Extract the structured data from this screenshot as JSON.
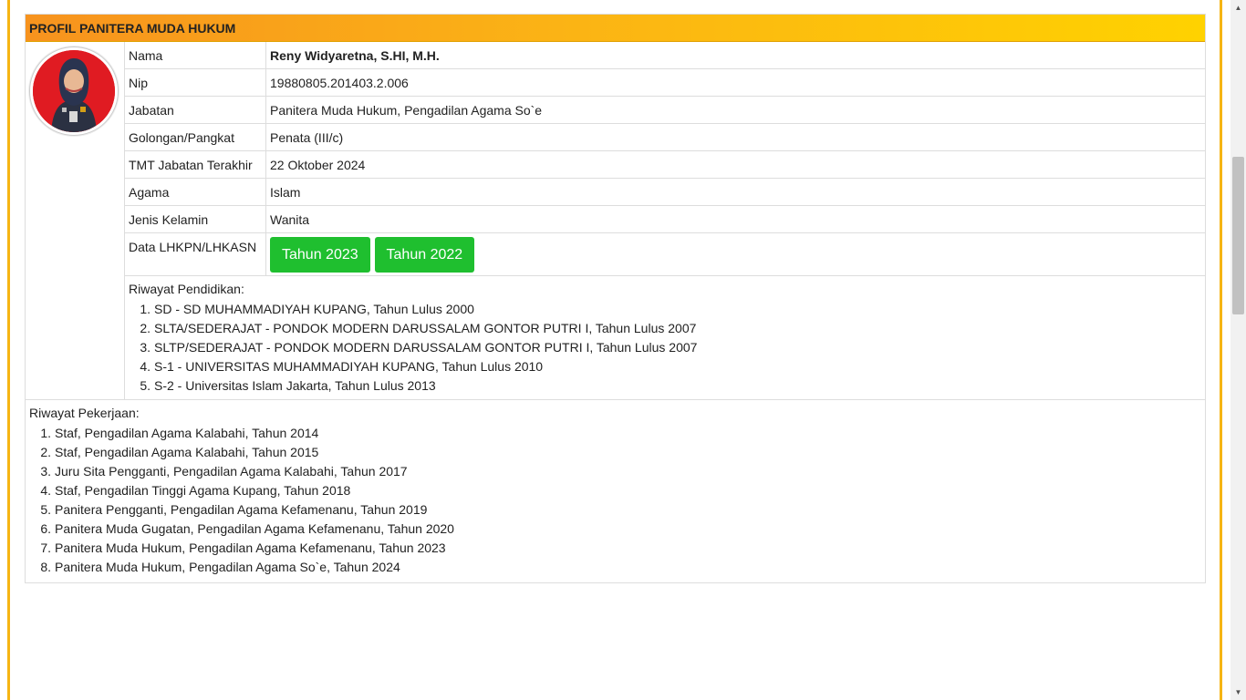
{
  "panel": {
    "title": "PROFIL PANITERA MUDA HUKUM"
  },
  "profile": {
    "rows": [
      {
        "label": "Nama",
        "value": "Reny Widyaretna, S.HI, M.H."
      },
      {
        "label": "Nip",
        "value": "19880805.201403.2.006"
      },
      {
        "label": "Jabatan",
        "value": "Panitera Muda Hukum, Pengadilan Agama So`e"
      },
      {
        "label": "Golongan/Pangkat",
        "value": "Penata (III/c)"
      },
      {
        "label": "TMT Jabatan Terakhir",
        "value": "22 Oktober 2024"
      },
      {
        "label": "Agama",
        "value": "Islam"
      },
      {
        "label": "Jenis Kelamin",
        "value": "Wanita"
      }
    ],
    "lhkpn": {
      "label": "Data LHKPN/LHKASN",
      "buttons": [
        "Tahun 2023",
        "Tahun 2022"
      ],
      "button_color": "#1fbf2f"
    }
  },
  "education": {
    "heading": "Riwayat Pendidikan:",
    "items": [
      "SD - SD MUHAMMADIYAH KUPANG, Tahun Lulus 2000",
      "SLTA/SEDERAJAT - PONDOK MODERN DARUSSALAM GONTOR PUTRI I, Tahun Lulus 2007",
      "SLTP/SEDERAJAT - PONDOK MODERN DARUSSALAM GONTOR PUTRI I, Tahun Lulus 2007",
      "S-1 - UNIVERSITAS MUHAMMADIYAH KUPANG, Tahun Lulus 2010",
      "S-2 - Universitas Islam Jakarta, Tahun Lulus 2013"
    ]
  },
  "work": {
    "heading": "Riwayat Pekerjaan:",
    "items": [
      "Staf, Pengadilan Agama Kalabahi, Tahun 2014",
      "Staf, Pengadilan Agama Kalabahi, Tahun 2015",
      "Juru Sita Pengganti, Pengadilan Agama Kalabahi, Tahun 2017",
      "Staf, Pengadilan Tinggi Agama Kupang, Tahun 2018",
      "Panitera Pengganti, Pengadilan Agama Kefamenanu, Tahun 2019",
      "Panitera Muda Gugatan, Pengadilan Agama Kefamenanu, Tahun 2020",
      "Panitera Muda Hukum, Pengadilan Agama Kefamenanu, Tahun 2023",
      "Panitera Muda Hukum, Pengadilan Agama So`e, Tahun 2024"
    ]
  },
  "colors": {
    "header_gradient_start": "#f7931e",
    "header_gradient_end": "#ffd200",
    "frame_border": "#f6b514"
  },
  "icons": {
    "avatar": "profile-photo",
    "scroll_up": "chevron-up-icon",
    "scroll_down": "chevron-down-icon"
  }
}
